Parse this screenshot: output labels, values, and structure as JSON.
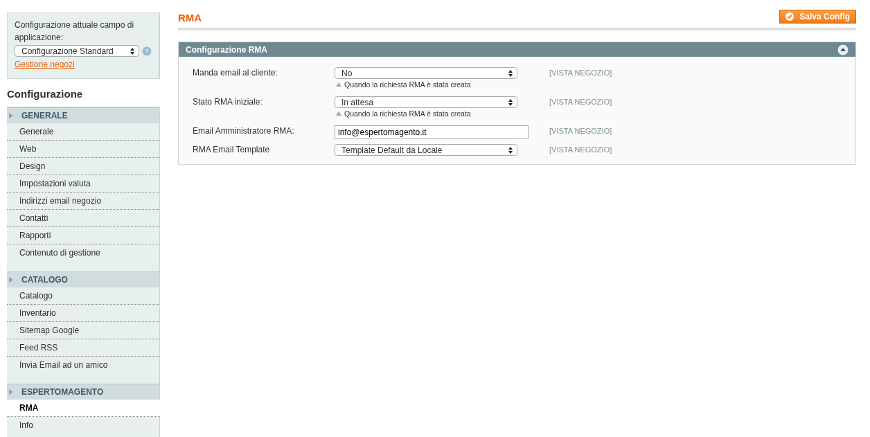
{
  "scope": {
    "label": "Configurazione attuale campo di applicazione:",
    "value": "Configurazione Standard",
    "link": "Gestione negozi",
    "help_icon": "?"
  },
  "sidebar": {
    "title": "Configurazione",
    "groups": [
      {
        "title": "GENERALE",
        "items": [
          {
            "label": "Generale",
            "selected": false
          },
          {
            "label": "Web",
            "selected": false
          },
          {
            "label": "Design",
            "selected": false
          },
          {
            "label": "Impostazioni valuta",
            "selected": false
          },
          {
            "label": "Indirizzi email negozio",
            "selected": false
          },
          {
            "label": "Contatti",
            "selected": false
          },
          {
            "label": "Rapporti",
            "selected": false
          },
          {
            "label": "Contenuto di gestione",
            "selected": false
          }
        ]
      },
      {
        "title": "CATALOGO",
        "items": [
          {
            "label": "Catalogo",
            "selected": false
          },
          {
            "label": "Inventario",
            "selected": false
          },
          {
            "label": "Sitemap Google",
            "selected": false
          },
          {
            "label": "Feed RSS",
            "selected": false
          },
          {
            "label": "Invia Email ad un amico",
            "selected": false
          }
        ]
      },
      {
        "title": "ESPERTOMAGENTO",
        "items": [
          {
            "label": "RMA",
            "selected": true
          },
          {
            "label": "Info",
            "selected": false
          }
        ]
      }
    ]
  },
  "page": {
    "title": "RMA",
    "save_button": "Salva Config"
  },
  "section": {
    "title": "Configurazione RMA",
    "expanded": true,
    "fields": [
      {
        "label": "Manda email al cliente:",
        "kind": "select",
        "value": "No",
        "note": "Quando la richiesta RMA è stata creata",
        "scope": "[VISTA NEGOZIO]"
      },
      {
        "label": "Stato RMA iniziale:",
        "kind": "select",
        "value": "In attesa",
        "note": "Quando la richiesta RMA è stata creata",
        "scope": "[VISTA NEGOZIO]"
      },
      {
        "label": "Email Amministratore RMA:",
        "kind": "input",
        "value": "info@espertomagento.it",
        "scope": "[VISTA NEGOZIO]"
      },
      {
        "label": "RMA Email Template",
        "kind": "select",
        "value": "Template Default da Locale",
        "scope": "[VISTA NEGOZIO]"
      }
    ]
  }
}
